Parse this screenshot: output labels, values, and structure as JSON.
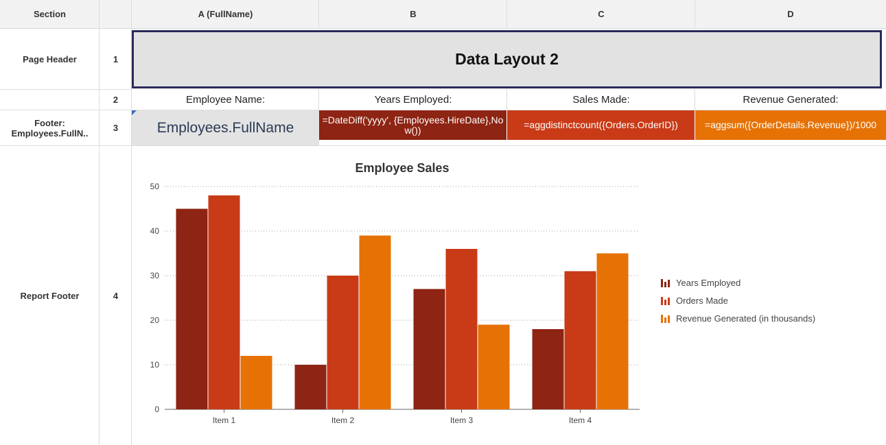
{
  "columns": {
    "section": "Section",
    "row": "",
    "a": "A (FullName)",
    "b": "B",
    "c": "C",
    "d": "D"
  },
  "rows": [
    {
      "section": "Page Header",
      "num": "1"
    },
    {
      "section": "",
      "num": "2"
    },
    {
      "section": "Footer:\nEmployees.FullN..",
      "num": "3"
    },
    {
      "section": "Report Footer",
      "num": "4"
    }
  ],
  "row1": {
    "title": "Data Layout 2"
  },
  "row2": {
    "a": "Employee Name:",
    "b": "Years Employed:",
    "c": "Sales Made:",
    "d": "Revenue Generated:"
  },
  "row3": {
    "a": "Employees.FullName",
    "b": "=DateDiff('yyyy', {Employees.HireDate},Now())",
    "c": "=aggdistinctcount({Orders.OrderID})",
    "d": "=aggsum({OrderDetails.Revenue})/1000"
  },
  "colors": {
    "series1": "#8e2413",
    "series2": "#c93a17",
    "series3": "#e67206"
  },
  "chart_data": {
    "type": "bar",
    "title": "Employee Sales",
    "xlabel": "",
    "ylabel": "",
    "categories": [
      "Item 1",
      "Item 2",
      "Item 3",
      "Item 4"
    ],
    "series": [
      {
        "name": "Years Employed",
        "values": [
          45,
          10,
          27,
          18
        ]
      },
      {
        "name": "Orders Made",
        "values": [
          48,
          30,
          36,
          31
        ]
      },
      {
        "name": "Revenue Generated (in thousands)",
        "values": [
          12,
          39,
          19,
          35
        ]
      }
    ],
    "ylim": [
      0,
      50
    ],
    "yticks": [
      "0",
      "10",
      "20",
      "30",
      "40",
      "50"
    ],
    "grid": true,
    "legend": "right"
  }
}
